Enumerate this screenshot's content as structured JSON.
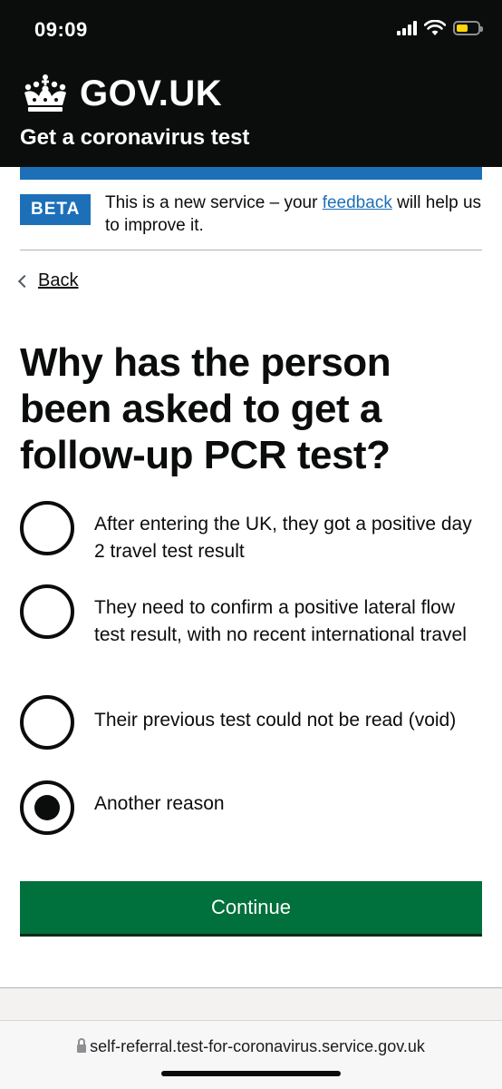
{
  "status_bar": {
    "time": "09:09",
    "icons": [
      "cellular-signal-icon",
      "wifi-icon",
      "battery-low-icon"
    ],
    "battery_color": "#ffd60a"
  },
  "header": {
    "brand": "GOV.UK",
    "logo_icon": "crown-icon",
    "service_name": "Get a coronavirus test",
    "background_color": "#0b0c0c",
    "accent_bar_color": "#1d70b8"
  },
  "phase_banner": {
    "tag": "BETA",
    "text_before": "This is a new service – your ",
    "link_text": "feedback",
    "text_after": " will help us to improve it."
  },
  "navigation": {
    "back_label": "Back"
  },
  "question": {
    "heading": "Why has the person been asked to get a follow-up PCR test?",
    "options": [
      {
        "label": "After entering the UK, they got a positive day 2 travel test result",
        "checked": false
      },
      {
        "label": "They need to confirm a positive lateral flow test result, with no recent international travel",
        "checked": false
      },
      {
        "label": "Their previous test could not be read (void)",
        "checked": false
      },
      {
        "label": "Another reason",
        "checked": true
      }
    ]
  },
  "actions": {
    "continue_label": "Continue",
    "button_color": "#00703c"
  },
  "browser": {
    "url": "self-referral.test-for-coronavirus.service.gov.uk"
  }
}
